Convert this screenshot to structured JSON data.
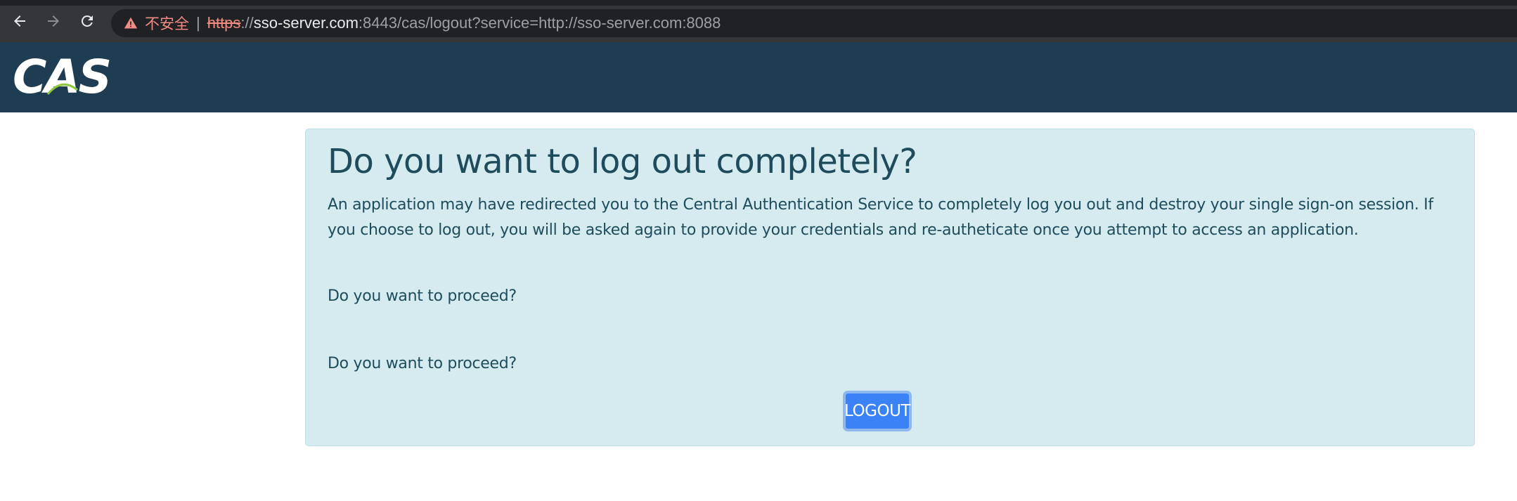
{
  "browser": {
    "icons": {
      "back": "back-arrow-icon",
      "forward": "forward-arrow-icon",
      "reload": "reload-icon",
      "warning": "warning-triangle-icon"
    },
    "security_label": "不安全",
    "separator": "|",
    "url": {
      "scheme": "https",
      "slashes": "://",
      "host": "sso-server.com",
      "rest": ":8443/cas/logout?service=http://sso-server.com:8088"
    }
  },
  "header": {
    "logo_text": "CAS",
    "background": "#1f3d52",
    "logo_accent": "#8dc63f"
  },
  "panel": {
    "title": "Do you want to log out completely?",
    "description": "An application may have redirected you to the Central Authentication Service to completely log you out and destroy your single sign-on session. If you choose to log out, you will be asked again to provide your credentials and re-autheticate once you attempt to access an application.",
    "question_1": "Do you want to proceed?",
    "question_2": "Do you want to proceed?",
    "logout_label": "LOGOUT",
    "background": "#d5ebf0",
    "text_color": "#1f4c5c",
    "button_color": "#3b82f6"
  }
}
